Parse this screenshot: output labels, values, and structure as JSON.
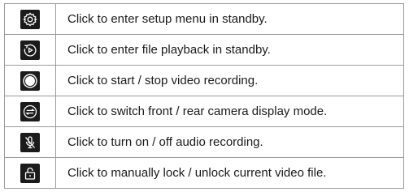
{
  "rows": [
    {
      "icon": "gear-icon",
      "text": "Click to enter setup menu in standby."
    },
    {
      "icon": "playback-icon",
      "text": "Click to enter file playback in standby."
    },
    {
      "icon": "record-icon",
      "text": "Click to start / stop video recording."
    },
    {
      "icon": "switch-camera-icon",
      "text": "Click to switch front / rear camera display mode."
    },
    {
      "icon": "mic-off-icon",
      "text": "Click to turn on / off audio recording."
    },
    {
      "icon": "lock-icon",
      "text": "Click to manually lock / unlock current video file."
    }
  ],
  "colors": {
    "icon_bg": "#1b1b1b",
    "icon_fg": "#ffffff",
    "border": "#9a9a9a",
    "text": "#1a1a1a"
  }
}
